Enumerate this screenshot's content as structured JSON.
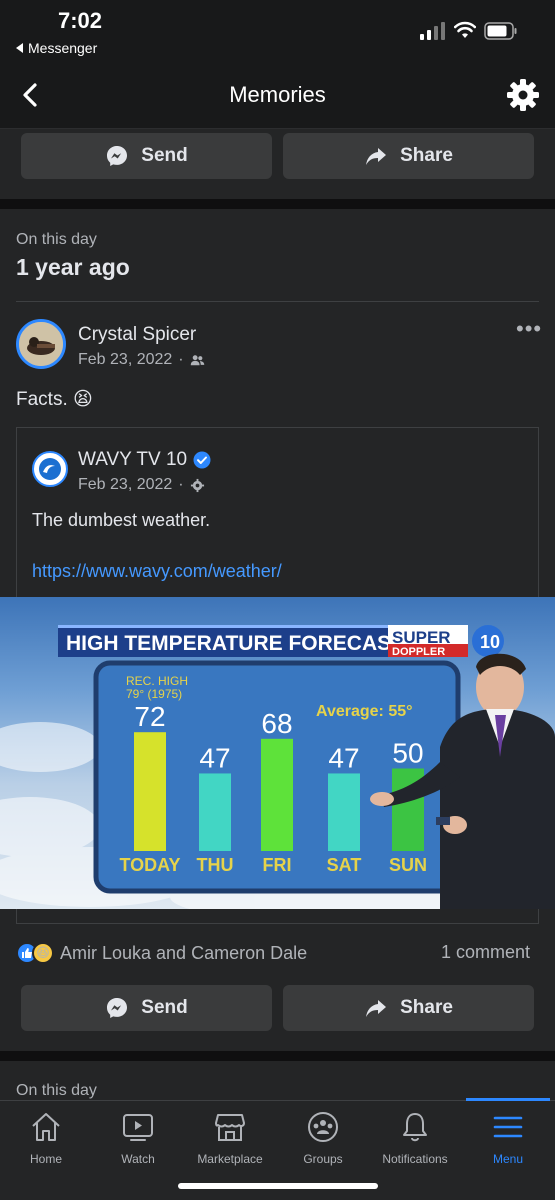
{
  "status": {
    "time": "7:02",
    "back_app": "Messenger"
  },
  "header": {
    "title": "Memories"
  },
  "top_actions": {
    "send_label": "Send",
    "share_label": "Share"
  },
  "memory": {
    "on_this_day": "On this day",
    "years_ago": "1 year ago",
    "post": {
      "author": "Crystal Spicer",
      "date": "Feb 23, 2022",
      "text": "Facts. 😫",
      "shared": {
        "author": "WAVY TV 10",
        "date": "Feb 23, 2022",
        "text": "The dumbest weather.",
        "link": "https://www.wavy.com/weather/"
      }
    },
    "reactions_text": "Amir Louka and Cameron Dale",
    "comments_text": "1 comment",
    "send_label": "Send",
    "share_label": "Share"
  },
  "weather_graphic": {
    "banner_title": "HIGH TEMPERATURE FORECAST",
    "logo_top": "SUPER",
    "logo_bottom": "DOPPLER",
    "rec_high_line1": "REC. HIGH",
    "rec_high_line2": "79° (1975)",
    "average": "Average: 55°",
    "days": [
      {
        "label": "TODAY",
        "temp": "72",
        "color": "#d6e22b"
      },
      {
        "label": "THU",
        "temp": "47",
        "color": "#42d6c4"
      },
      {
        "label": "FRI",
        "temp": "68",
        "color": "#5ee23a"
      },
      {
        "label": "SAT",
        "temp": "47",
        "color": "#42d6c4"
      },
      {
        "label": "SUN",
        "temp": "50",
        "color": "#3cc443"
      }
    ]
  },
  "next_section": {
    "on_this_day": "On this day"
  },
  "tabs": [
    {
      "label": "Home",
      "icon": "home-icon"
    },
    {
      "label": "Watch",
      "icon": "watch-icon"
    },
    {
      "label": "Marketplace",
      "icon": "marketplace-icon"
    },
    {
      "label": "Groups",
      "icon": "groups-icon"
    },
    {
      "label": "Notifications",
      "icon": "bell-icon"
    },
    {
      "label": "Menu",
      "icon": "menu-icon",
      "active": true
    }
  ]
}
